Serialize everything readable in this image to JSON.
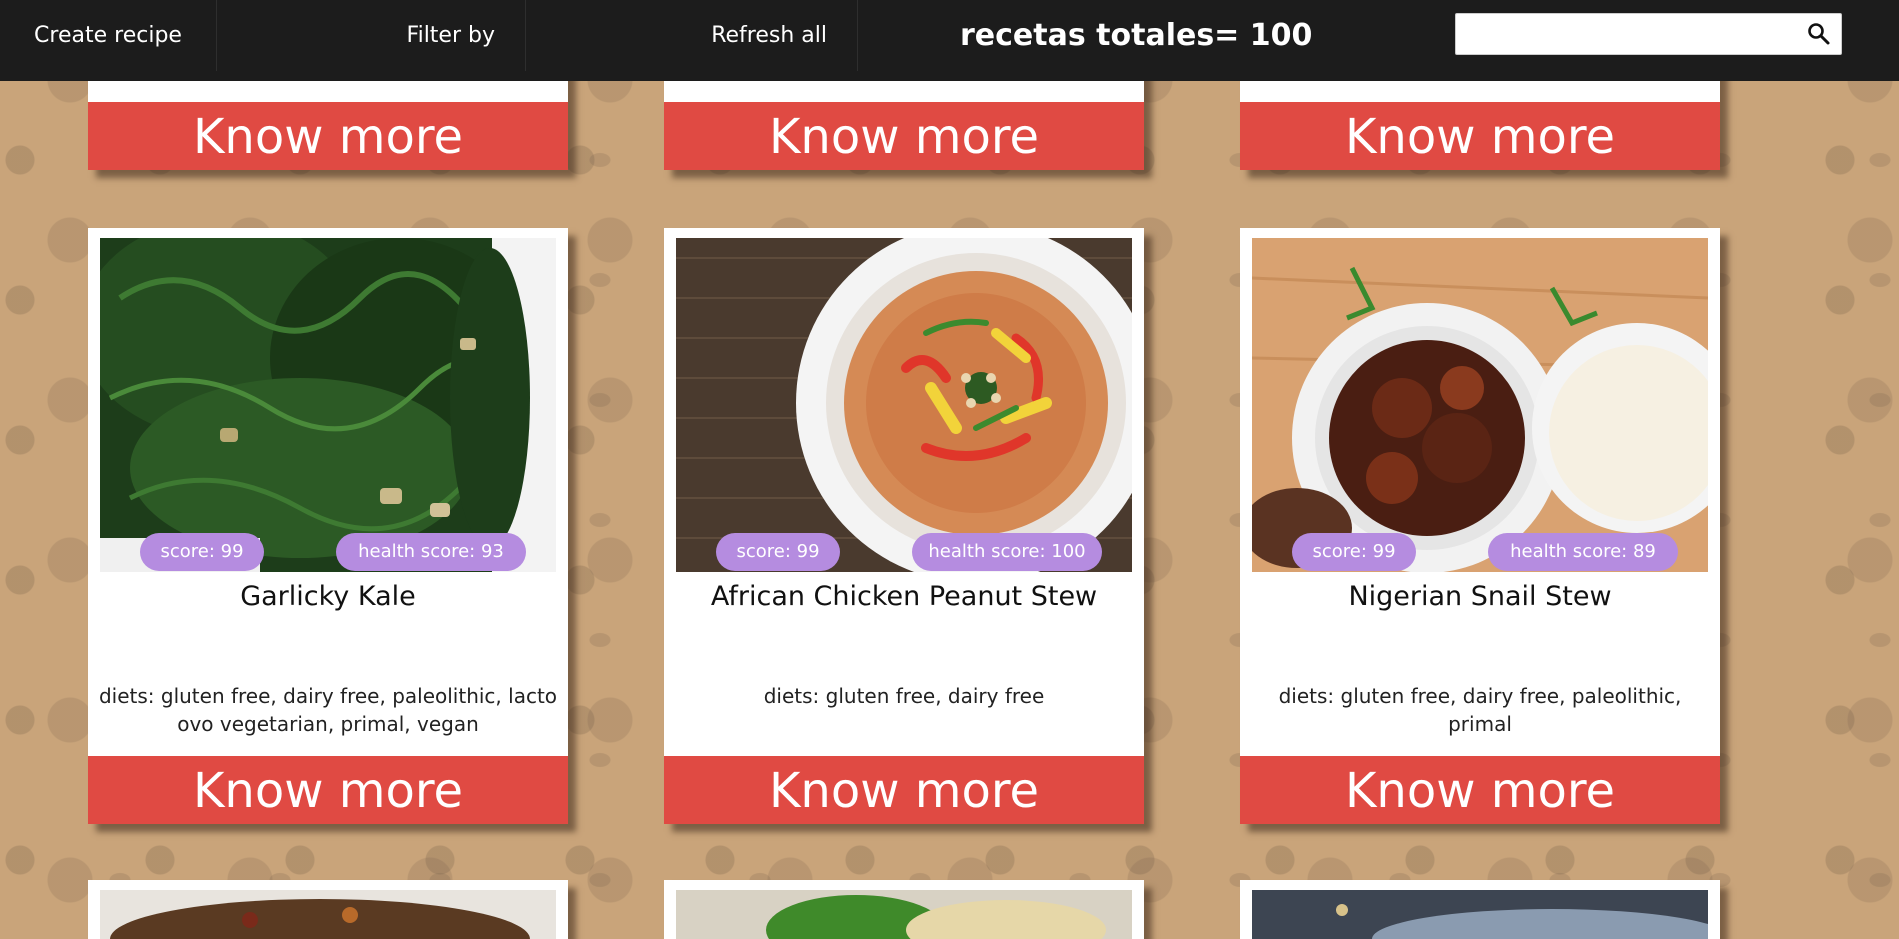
{
  "nav": {
    "create_label": "Create recipe",
    "filter_label": "Filter by",
    "refresh_label": "Refresh all",
    "total_label": "recetas totales= 100",
    "search_placeholder": "",
    "search_icon": "search-icon"
  },
  "top_row": {
    "know_more_label": "Know more"
  },
  "cards": [
    {
      "title": "Garlicky Kale",
      "score": "score: 99",
      "health_score": "health score: 93",
      "diets": "diets: gluten free, dairy free, paleolithic, lacto ovo vegetarian, primal, vegan",
      "know_more": "Know more"
    },
    {
      "title": "African Chicken Peanut Stew",
      "score": "score: 99",
      "health_score": "health score: 100",
      "diets": "diets: gluten free, dairy free",
      "know_more": "Know more"
    },
    {
      "title": "Nigerian Snail Stew",
      "score": "score: 99",
      "health_score": "health score: 89",
      "diets": "diets: gluten free, dairy free, paleolithic, primal",
      "know_more": "Know more"
    }
  ],
  "colors": {
    "nav_bg": "#1c1c1c",
    "button_red": "#e04a43",
    "pill_purple": "#b58ce0",
    "page_bg": "#c9a47a"
  }
}
